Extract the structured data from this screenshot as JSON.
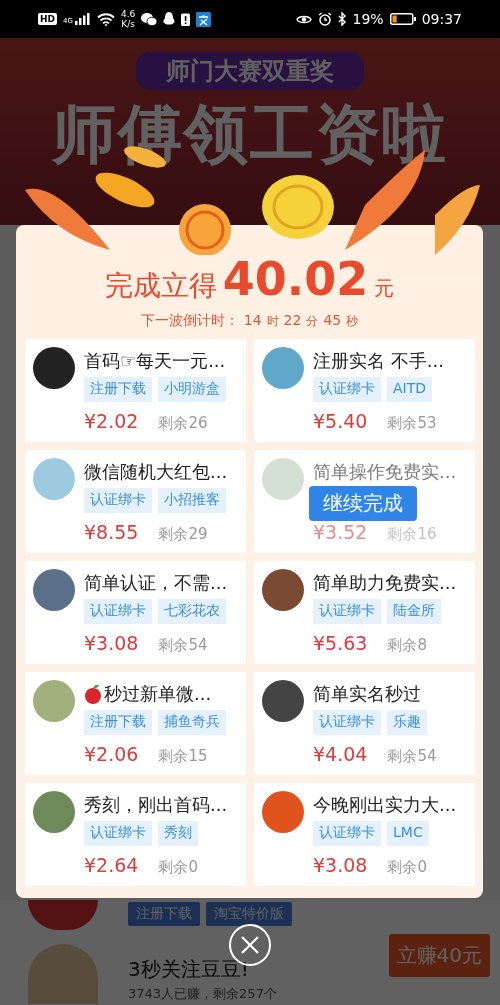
{
  "status_bar": {
    "left": [
      "HD",
      "4G"
    ],
    "speed": [
      "4.6",
      "K/s"
    ],
    "battery": "19%",
    "time": "09:37"
  },
  "banner": {
    "badge": "师门大赛双重奖",
    "headline": "师傅领工资啦"
  },
  "background_item": {
    "tags": [
      "注册下载",
      "淘宝特价版"
    ],
    "title": "3秒关注豆豆!",
    "meta": "3743人已赚，剩余257个",
    "button": "立赚40元"
  },
  "modal": {
    "reward_prefix": "完成立得",
    "reward_amount": "40.02",
    "reward_unit": "元",
    "countdown_label": "下一波倒计时：",
    "countdown": [
      {
        "value": "14",
        "unit": "时"
      },
      {
        "value": "22",
        "unit": "分"
      },
      {
        "value": "45",
        "unit": "秒"
      }
    ],
    "tasks": [
      {
        "title": "首码☞每天一元...",
        "kind": "plain",
        "tags": [
          "注册下载",
          "小明游盒"
        ],
        "price": "¥2.02",
        "remaining": "剩余26",
        "dimmed": false
      },
      {
        "title": "注册实名 不手...",
        "kind": "plain",
        "tags": [
          "认证绑卡",
          "AITD"
        ],
        "price": "¥5.40",
        "remaining": "剩余53",
        "dimmed": false
      },
      {
        "title": "微信随机大红包...",
        "kind": "plain",
        "tags": [
          "认证绑卡",
          "小招推客"
        ],
        "price": "¥8.55",
        "remaining": "剩余29",
        "dimmed": false
      },
      {
        "title": "简单操作免费实...",
        "kind": "plain",
        "price": "¥3.52",
        "remaining": "剩余16",
        "dimmed": true,
        "action": "继续完成"
      },
      {
        "title": "简单认证，不需...",
        "kind": "plain",
        "tags": [
          "认证绑卡",
          "七彩花农"
        ],
        "price": "¥3.08",
        "remaining": "剩余54",
        "dimmed": false
      },
      {
        "title": "简单助力免费实...",
        "kind": "plain",
        "tags": [
          "认证绑卡",
          "陆金所"
        ],
        "price": "¥5.63",
        "remaining": "剩余8",
        "dimmed": false
      },
      {
        "title": "秒过新单微...",
        "kind": "apple",
        "tags": [
          "注册下载",
          "捕鱼奇兵"
        ],
        "price": "¥2.06",
        "remaining": "剩余15",
        "dimmed": false
      },
      {
        "title": "简单实名秒过",
        "kind": "plain",
        "tags": [
          "认证绑卡",
          "乐趣"
        ],
        "price": "¥4.04",
        "remaining": "剩余54",
        "dimmed": false
      },
      {
        "title": "秀刻，刚出首码...",
        "kind": "plain",
        "tags": [
          "认证绑卡",
          "秀刻"
        ],
        "price": "¥2.64",
        "remaining": "剩余0",
        "dimmed": false
      },
      {
        "title": "今晚刚出实力大...",
        "kind": "plain",
        "tags": [
          "认证绑卡",
          "LMC"
        ],
        "price": "¥3.08",
        "remaining": "剩余0",
        "dimmed": false
      }
    ]
  }
}
